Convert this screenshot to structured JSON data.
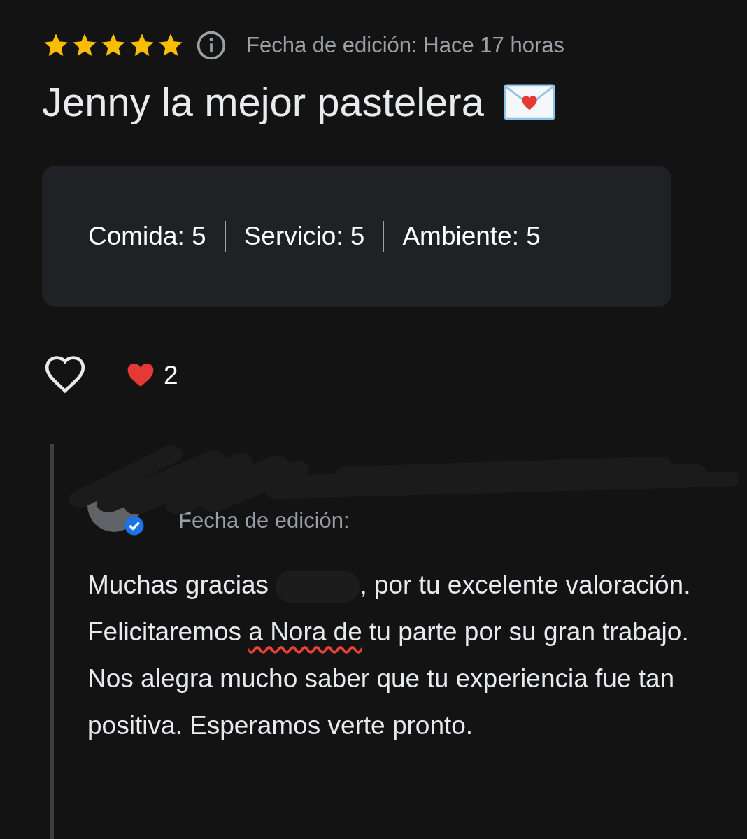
{
  "review": {
    "stars": 5,
    "date": "Fecha de edición: Hace 17 horas",
    "title": "Jenny la mejor pastelera",
    "scores": [
      {
        "label": "Comida:",
        "value": "5"
      },
      {
        "label": "Servicio:",
        "value": "5"
      },
      {
        "label": "Ambiente:",
        "value": "5"
      }
    ],
    "liked": false,
    "reaction_count": "2"
  },
  "reply": {
    "date_label": "Fecha de edición:",
    "verified": true,
    "parts": [
      {
        "kind": "text",
        "text": "Muchas gracias "
      },
      {
        "kind": "redacted"
      },
      {
        "kind": "text",
        "text": ", por tu excelente valoración. Felicitaremos "
      },
      {
        "kind": "misspelled",
        "text": "a Nora de"
      },
      {
        "kind": "text",
        "text": " tu parte por su gran trabajo. Nos alegra mucho saber que tu experiencia fue tan positiva. Esperamos verte pronto."
      }
    ]
  }
}
